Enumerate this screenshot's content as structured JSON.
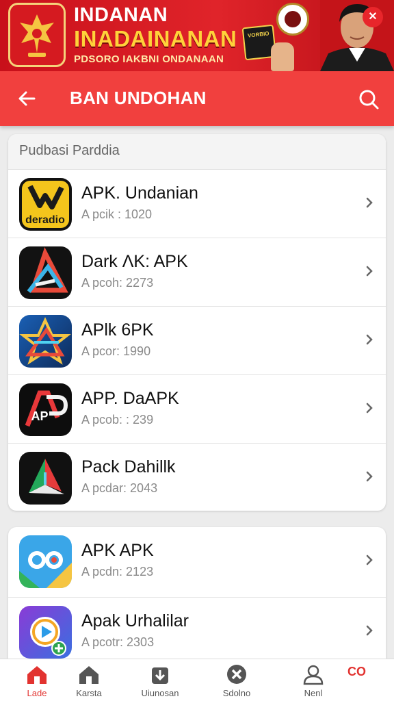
{
  "banner": {
    "title_line1": "INDANAN",
    "title_line2": "INADAINANAN",
    "subtitle": "PDSORO IAKBNI ONDANAAN",
    "sign_text": "VORBIO",
    "close_symbol": "✕"
  },
  "appbar": {
    "title": "BAN UNDOHAN",
    "back_icon": "arrow-left-icon",
    "search_icon": "search-icon"
  },
  "section1": {
    "header": "Pudbasi Parddia",
    "items": [
      {
        "name": "APK. Undanian",
        "sub": "A pcik : 1020",
        "icon": "yellow-logo-icon",
        "icon_text": "deradio"
      },
      {
        "name": "Dark ΛK: APK",
        "sub": "A pcoh: 2273",
        "icon": "dark-triangle-icon"
      },
      {
        "name": "APlk 6PK",
        "sub": "A pcor: 1990",
        "icon": "blue-star-icon"
      },
      {
        "name": "APP. DaAPK",
        "sub": "A pcob: : 239",
        "icon": "ap-logo-icon",
        "icon_text": "AP"
      },
      {
        "name": "Pack Dahillk",
        "sub": "A pcdar: 2043",
        "icon": "green-triangle-icon"
      }
    ]
  },
  "section2": {
    "items": [
      {
        "name": "APK APK",
        "sub": "A pcdn: 2123",
        "icon": "maps-style-icon",
        "icon_text": "OO"
      },
      {
        "name": "Apak Urhalilar",
        "sub": "A pcotr: 2303",
        "icon": "purple-play-icon"
      }
    ]
  },
  "bottomnav": {
    "items": [
      {
        "label": "Lade",
        "icon": "home-icon",
        "active": true
      },
      {
        "label": "Karsta",
        "icon": "house-icon",
        "active": false
      },
      {
        "label": "Uiunosan",
        "icon": "download-box-icon",
        "active": false
      },
      {
        "label": "Sdolno",
        "icon": "close-circle-icon",
        "active": false
      },
      {
        "label": "Nenl",
        "icon": "user-icon",
        "active": false
      }
    ],
    "extra_text": "CO"
  },
  "colors": {
    "appbar": "#f1403e",
    "banner": "#d51a20",
    "accent_yellow": "#ffd23a",
    "active": "#e23330"
  }
}
